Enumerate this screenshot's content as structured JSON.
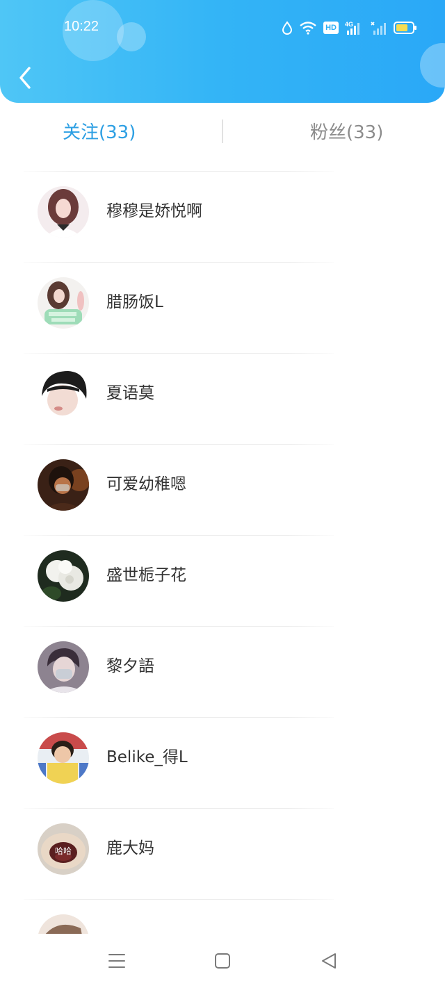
{
  "status_bar": {
    "time": "10:22",
    "icons": [
      "water-drop-icon",
      "wifi-icon",
      "hd-icon",
      "signal-4g-icon",
      "signal-icon",
      "battery-icon"
    ],
    "hd_label": "HD",
    "network_label": "4G"
  },
  "header": {
    "back_icon": "chevron-left-icon",
    "gradient": [
      "#4fc6f6",
      "#2aa8f7"
    ]
  },
  "tabs": [
    {
      "label": "关注(33)",
      "active": true
    },
    {
      "label": "粉丝(33)",
      "active": false
    }
  ],
  "colors": {
    "active_tab": "#2d9fe3",
    "inactive_tab": "#8c8c8c",
    "name_text": "#333333"
  },
  "users": [
    {
      "name": "穆穆是娇悦啊"
    },
    {
      "name": "腊肠饭L"
    },
    {
      "name": "夏语莫"
    },
    {
      "name": "可爱幼稚嗯"
    },
    {
      "name": "盛世栀子花"
    },
    {
      "name": "黎夕語"
    },
    {
      "name": "Belike_得L"
    },
    {
      "name": "鹿大妈",
      "avatar_caption": "哈哈"
    },
    {
      "name": ""
    }
  ],
  "nav_bar": [
    "menu-icon",
    "home-square-icon",
    "back-triangle-icon"
  ]
}
